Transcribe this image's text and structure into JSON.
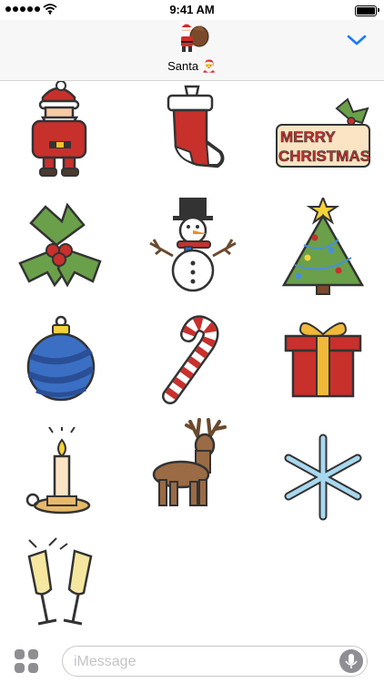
{
  "status": {
    "time": "9:41 AM"
  },
  "header": {
    "contact_name": "Santa",
    "contact_emoji": "🎅",
    "collapse_icon": "chevron-down-icon"
  },
  "stickers": [
    {
      "name": "santa",
      "lettering": ""
    },
    {
      "name": "stocking",
      "lettering": ""
    },
    {
      "name": "merry-christmas",
      "lettering": "MERRY CHRISTMAS"
    },
    {
      "name": "holly",
      "lettering": ""
    },
    {
      "name": "snowman",
      "lettering": ""
    },
    {
      "name": "christmas-tree",
      "lettering": ""
    },
    {
      "name": "ornament",
      "lettering": ""
    },
    {
      "name": "candy-cane",
      "lettering": ""
    },
    {
      "name": "gift",
      "lettering": ""
    },
    {
      "name": "candle",
      "lettering": ""
    },
    {
      "name": "reindeer",
      "lettering": ""
    },
    {
      "name": "snowflake",
      "lettering": ""
    },
    {
      "name": "champagne-glasses",
      "lettering": ""
    }
  ],
  "composer": {
    "placeholder": "iMessage",
    "apps_icon": "apps-icon",
    "mic_icon": "microphone-icon"
  },
  "colors": {
    "accent": "#1a7cf5",
    "header_bg": "#f7f7f7"
  }
}
